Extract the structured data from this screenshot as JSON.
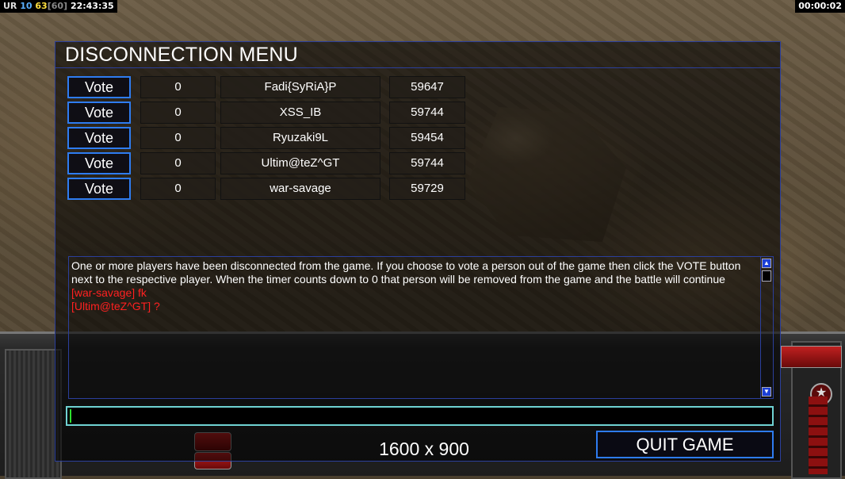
{
  "status_bar": {
    "left_ur": "UR",
    "left_10": "10",
    "left_63": "63",
    "left_60": "[60]",
    "left_clock": "22:43:35",
    "right_timer": "00:00:02"
  },
  "dialog": {
    "title": "DISCONNECTION MENU",
    "vote_label": "Vote",
    "players": [
      {
        "votes": "0",
        "name": "Fadi{SyRiA}P",
        "ping": "59647"
      },
      {
        "votes": "0",
        "name": "XSS_IB",
        "ping": "59744"
      },
      {
        "votes": "0",
        "name": "Ryuzaki9L",
        "ping": "59454"
      },
      {
        "votes": "0",
        "name": "Ultim@teZ^GT",
        "ping": "59744"
      },
      {
        "votes": "0",
        "name": "war-savage",
        "ping": "59729"
      }
    ],
    "chat": {
      "info": "One or more players have been disconnected from the game. If you choose to vote a person out of the game then click the VOTE button next to the respective player. When the timer counts down to 0 that person will be removed from the game and the battle will continue",
      "messages": [
        "[war-savage] fk",
        "[Ultim@teZ^GT] ?"
      ]
    },
    "chat_input_value": "",
    "resolution_label": "1600 x 900",
    "quit_label": "QUIT GAME"
  },
  "colors": {
    "border_blue": "#2b3f9c",
    "button_blue": "#2e7cf0",
    "chat_red": "#ff2020",
    "input_cyan": "#6fd3d3"
  }
}
